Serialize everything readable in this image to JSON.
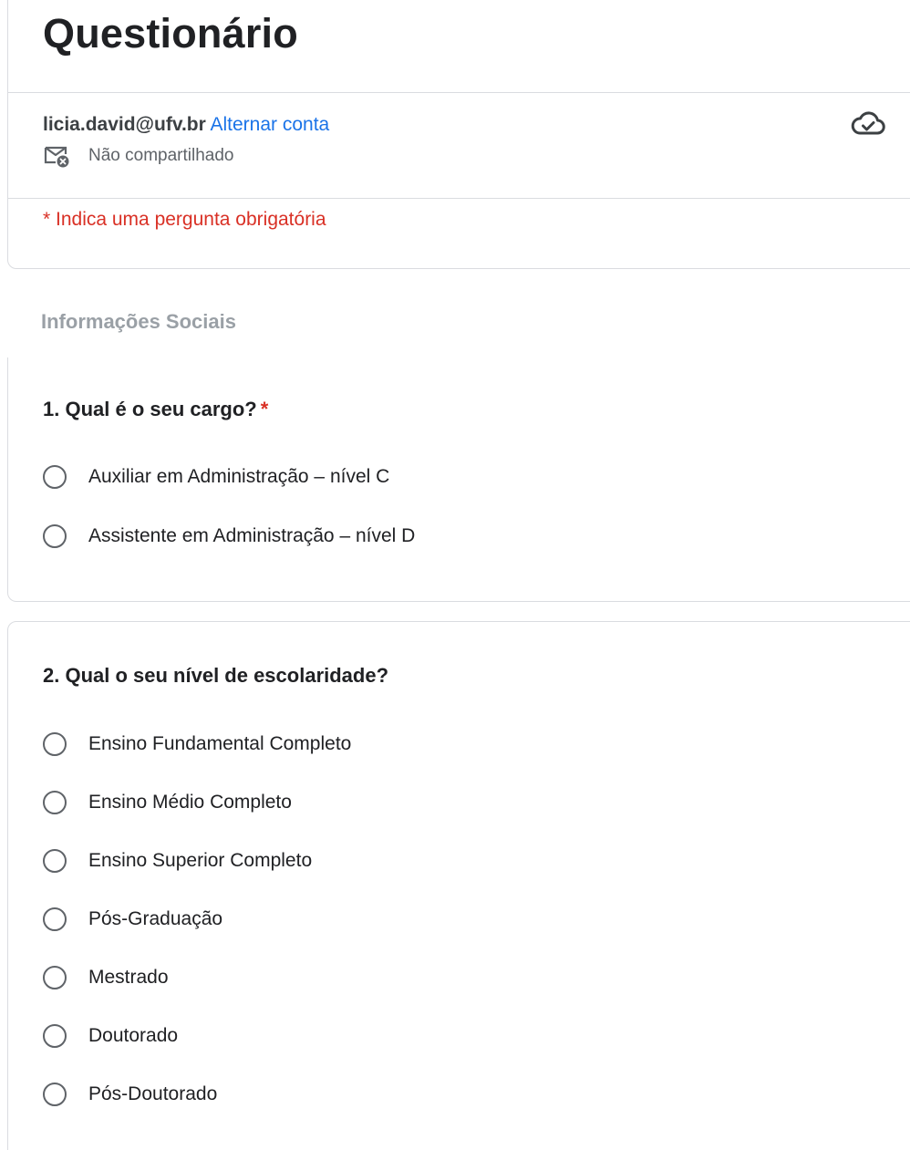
{
  "form": {
    "title": "Questionário",
    "account_email": "licia.david@ufv.br",
    "switch_account_label": "Alternar conta",
    "share_status": "Não compartilhado",
    "required_note": "* Indica uma pergunta obrigatória"
  },
  "section": {
    "title": "Informações Sociais"
  },
  "questions": [
    {
      "title": "1. Qual é o seu cargo?",
      "required_mark": "*",
      "options": [
        "Auxiliar em Administração – nível C",
        "Assistente em Administração – nível D"
      ]
    },
    {
      "title": "2.  Qual o seu nível de escolaridade?",
      "options": [
        "Ensino Fundamental Completo",
        "Ensino Médio Completo",
        "Ensino Superior Completo",
        "Pós-Graduação",
        "Mestrado",
        "Doutorado",
        "Pós-Doutorado"
      ]
    }
  ],
  "icons": {
    "cloud": "cloud-check-icon",
    "mail": "mail-off-icon"
  },
  "colors": {
    "link": "#1a73e8",
    "required": "#d93025",
    "border": "#dadce0",
    "muted": "#5f6368"
  }
}
